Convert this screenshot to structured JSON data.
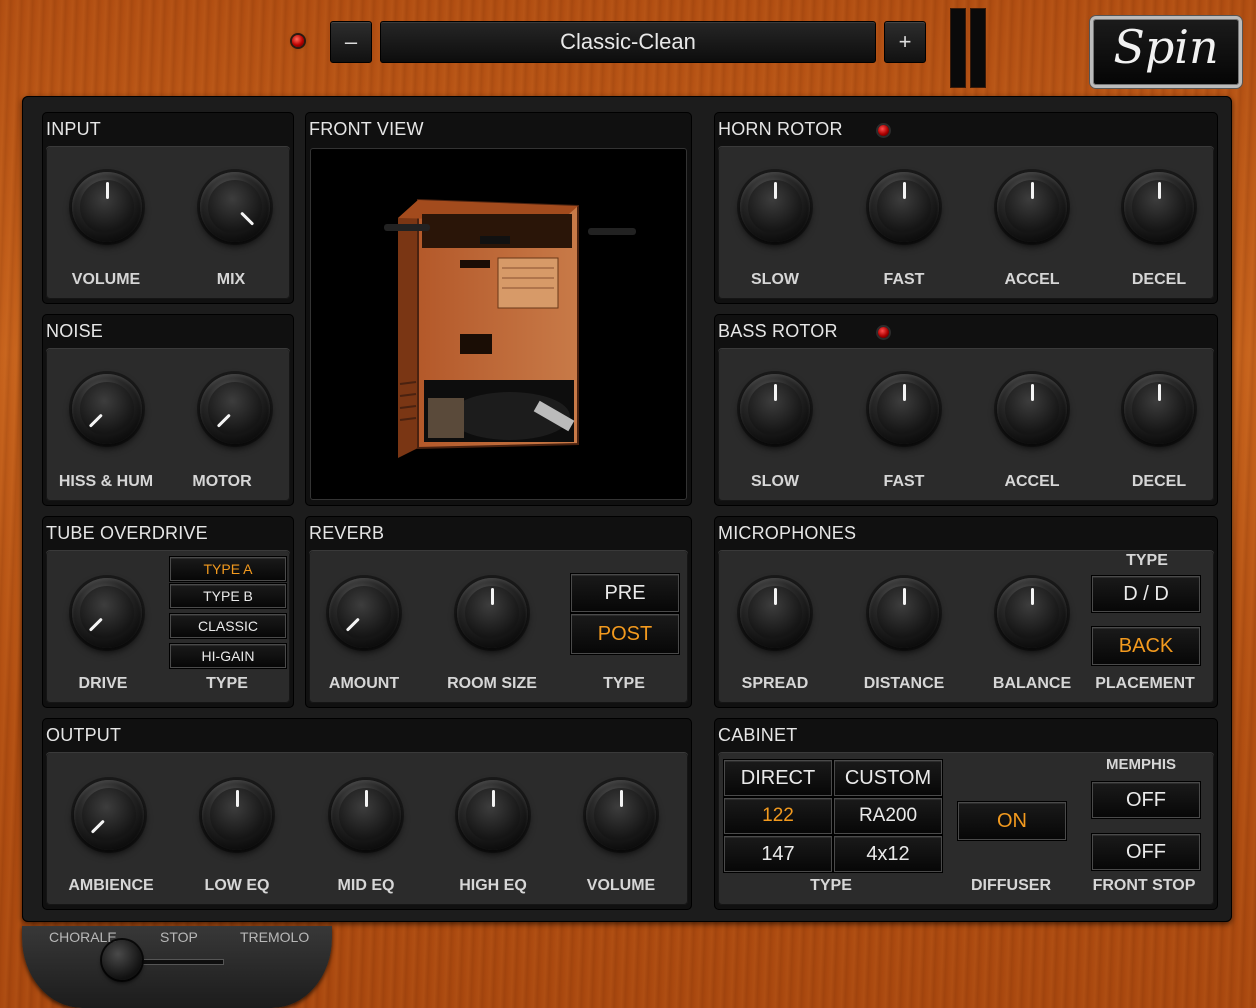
{
  "header": {
    "preset_name": "Classic-Clean",
    "prev_label": "–",
    "next_label": "+",
    "logo_text": "Spin"
  },
  "input": {
    "title": "INPUT",
    "knobs": [
      {
        "label": "VOLUME"
      },
      {
        "label": "MIX"
      }
    ]
  },
  "noise": {
    "title": "NOISE",
    "knobs": [
      {
        "label": "HISS & HUM"
      },
      {
        "label": "MOTOR"
      }
    ]
  },
  "front_view": {
    "title": "FRONT VIEW"
  },
  "horn_rotor": {
    "title": "HORN ROTOR",
    "knobs": [
      {
        "label": "SLOW"
      },
      {
        "label": "FAST"
      },
      {
        "label": "ACCEL"
      },
      {
        "label": "DECEL"
      }
    ]
  },
  "bass_rotor": {
    "title": "BASS ROTOR",
    "knobs": [
      {
        "label": "SLOW"
      },
      {
        "label": "FAST"
      },
      {
        "label": "ACCEL"
      },
      {
        "label": "DECEL"
      }
    ]
  },
  "tube_overdrive": {
    "title": "TUBE OVERDRIVE",
    "drive_label": "DRIVE",
    "type_label": "TYPE",
    "types": [
      "TYPE A",
      "TYPE B",
      "CLASSIC",
      "HI-GAIN"
    ],
    "selected_type": "TYPE A"
  },
  "reverb": {
    "title": "REVERB",
    "knobs": [
      {
        "label": "AMOUNT"
      },
      {
        "label": "ROOM SIZE"
      }
    ],
    "type_label": "TYPE",
    "pre_label": "PRE",
    "post_label": "POST",
    "selected": "POST"
  },
  "microphones": {
    "title": "MICROPHONES",
    "knobs": [
      {
        "label": "SPREAD"
      },
      {
        "label": "DISTANCE"
      },
      {
        "label": "BALANCE"
      }
    ],
    "type_header": "TYPE",
    "type_value": "D / D",
    "placement_value": "BACK",
    "placement_label": "PLACEMENT"
  },
  "output": {
    "title": "OUTPUT",
    "knobs": [
      {
        "label": "AMBIENCE"
      },
      {
        "label": "LOW EQ"
      },
      {
        "label": "MID EQ"
      },
      {
        "label": "HIGH EQ"
      },
      {
        "label": "VOLUME"
      }
    ]
  },
  "cabinet": {
    "title": "CABINET",
    "direct_label": "DIRECT",
    "custom_label": "CUSTOM",
    "opt_122": "122",
    "opt_ra200": "RA200",
    "opt_147": "147",
    "opt_4x12": "4x12",
    "selected": "122",
    "type_label": "TYPE",
    "diffuser_value": "ON",
    "diffuser_label": "DIFFUSER",
    "memphis_label": "MEMPHIS",
    "memphis_value": "OFF",
    "front_stop_value": "OFF",
    "front_stop_label": "FRONT STOP"
  },
  "speed_switch": {
    "chorale": "CHORALE",
    "stop": "STOP",
    "tremolo": "TREMOLO"
  },
  "colors": {
    "accent": "#f39a1e",
    "wood": "#c0591a",
    "panel": "#1c1c1c",
    "led": "#e02020"
  }
}
